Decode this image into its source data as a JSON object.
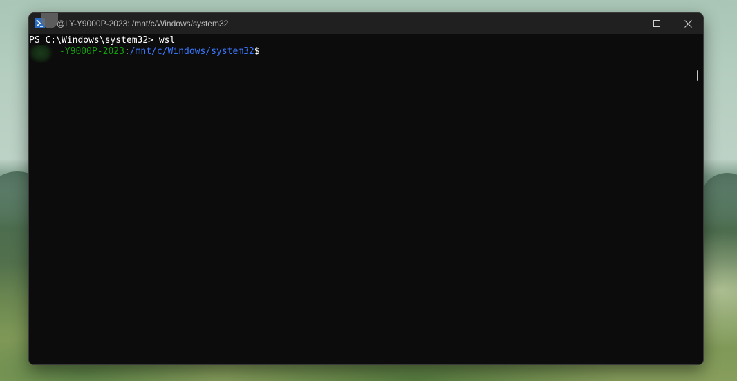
{
  "window": {
    "title": "@LY-Y9000P-2023: /mnt/c/Windows/system32",
    "tab_icon": "linux-terminal-icon",
    "controls": {
      "minimize_icon": "minimize-icon",
      "maximize_icon": "maximize-icon",
      "close_icon": "close-icon"
    }
  },
  "terminal": {
    "line1": "PS C:\\Windows\\system32> wsl",
    "prompt": {
      "host": "-Y9000P-2023",
      "colon": ":",
      "path": "/mnt/c/Windows/system32",
      "symbol": "$"
    }
  },
  "colors": {
    "background": "#0c0c0c",
    "titlebar": "#202020",
    "host_green": "#13a10e",
    "path_blue": "#3b78ff",
    "text": "#cccccc"
  }
}
